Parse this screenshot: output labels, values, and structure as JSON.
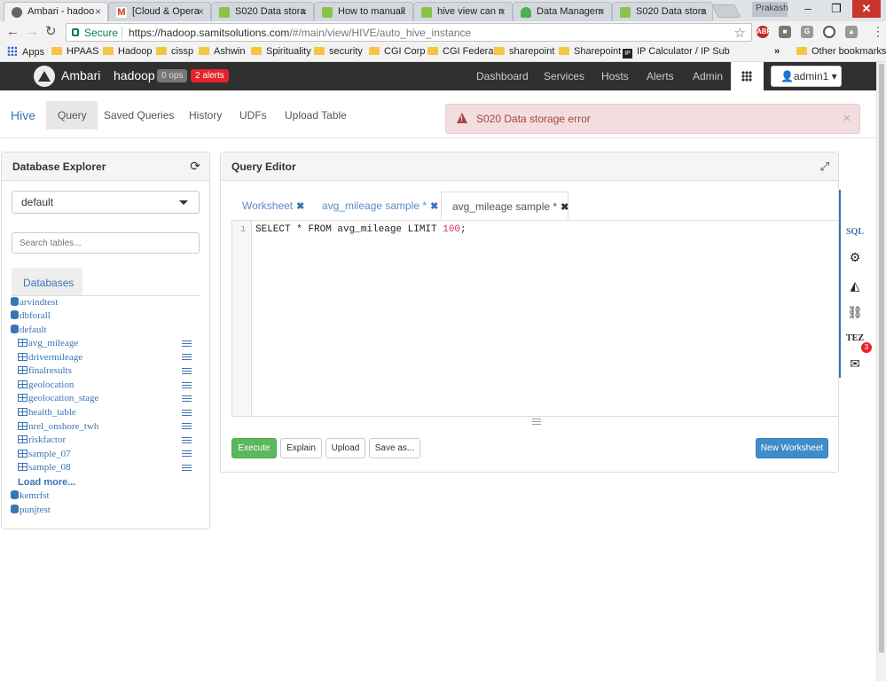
{
  "browser": {
    "tabs": [
      {
        "title": "Ambari - hadoo",
        "color": "#666666"
      },
      {
        "title": "[Cloud & Opera",
        "color": "#d93025"
      },
      {
        "title": "S020 Data stora",
        "color": "#8bc34a"
      },
      {
        "title": "How to manuall",
        "color": "#8bc34a"
      },
      {
        "title": "hive view can n",
        "color": "#8bc34a"
      },
      {
        "title": "Data Managem",
        "color": "#4caf50"
      },
      {
        "title": "S020 Data stora",
        "color": "#8bc34a"
      }
    ],
    "user": "Prakash",
    "secure_label": "Secure",
    "url_host": "https://hadoop.samitsolutions.com",
    "url_path": "/#/main/view/HIVE/auto_hive_instance",
    "bookmarks": [
      "Apps",
      "HPAAS",
      "Hadoop",
      "cissp",
      "Ashwin",
      "Spirituality",
      "security",
      "CGI Corp",
      "CGI Federal",
      "sharepoint",
      "Sharepoint",
      "IP Calculator / IP Sub"
    ],
    "more_bookmarks": "»",
    "other_bookmarks": "Other bookmarks"
  },
  "ambari": {
    "brand": "Ambari",
    "cluster": "hadoop",
    "ops": "0 ops",
    "alerts": "2 alerts",
    "nav": [
      "Dashboard",
      "Services",
      "Hosts",
      "Alerts",
      "Admin"
    ],
    "admin_user": "admin1"
  },
  "subnav": {
    "title": "Hive",
    "tabs": [
      "Query",
      "Saved Queries",
      "History",
      "UDFs",
      "Upload Table"
    ],
    "active": "Query"
  },
  "alert": {
    "message": "S020 Data storage error",
    "color": "#a94442"
  },
  "explorer": {
    "title": "Database Explorer",
    "selected_db": "default",
    "search_placeholder": "Search tables...",
    "tab": "Databases",
    "databases_top": [
      "arvindtest",
      "dbforall",
      "default"
    ],
    "tables": [
      "avg_mileage",
      "drivermileage",
      "finalresults",
      "geolocation",
      "geolocation_stage",
      "health_table",
      "nrel_onshore_twh",
      "riskfactor",
      "sample_07",
      "sample_08"
    ],
    "load_more": "Load more...",
    "databases_bottom": [
      "kemrfst",
      "punjtest"
    ]
  },
  "editor": {
    "title": "Query Editor",
    "tabs": [
      "Worksheet",
      "avg_mileage sample *",
      "avg_mileage sample *"
    ],
    "active_tab": 2,
    "line_number": "1",
    "query_kw": "SELECT * FROM avg_mileage LIMIT ",
    "query_num": "100",
    "query_end": ";",
    "buttons": {
      "execute": "Execute",
      "explain": "Explain",
      "upload": "Upload",
      "save_as": "Save as...",
      "new_worksheet": "New Worksheet"
    }
  },
  "sidebar": {
    "sql": "SQL",
    "tez": "TEZ",
    "notifications": "3"
  }
}
